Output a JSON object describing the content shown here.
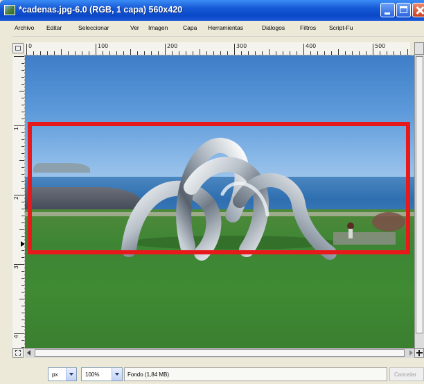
{
  "window": {
    "title": "*cadenas.jpg-6.0 (RGB, 1 capa) 560x420",
    "icon": "gimp-image-icon"
  },
  "menu": {
    "items": [
      "Archivo",
      "Editar",
      "Seleccionar",
      "Ver",
      "Imagen",
      "Capa",
      "Herramientas",
      "Diálogos",
      "Filtros",
      "Script-Fu"
    ]
  },
  "ruler": {
    "horizontal_labels": [
      "0",
      "100",
      "200",
      "300",
      "400",
      "500"
    ],
    "vertical_labels": [
      "1",
      "2",
      "3",
      "4"
    ]
  },
  "status": {
    "unit": "px",
    "zoom": "100%",
    "layer_info": "Fondo (1,84 MB)",
    "cancel_label": "Cancelar"
  },
  "colors": {
    "highlight": "#e8191b",
    "titlebar": "#0a48c8"
  }
}
